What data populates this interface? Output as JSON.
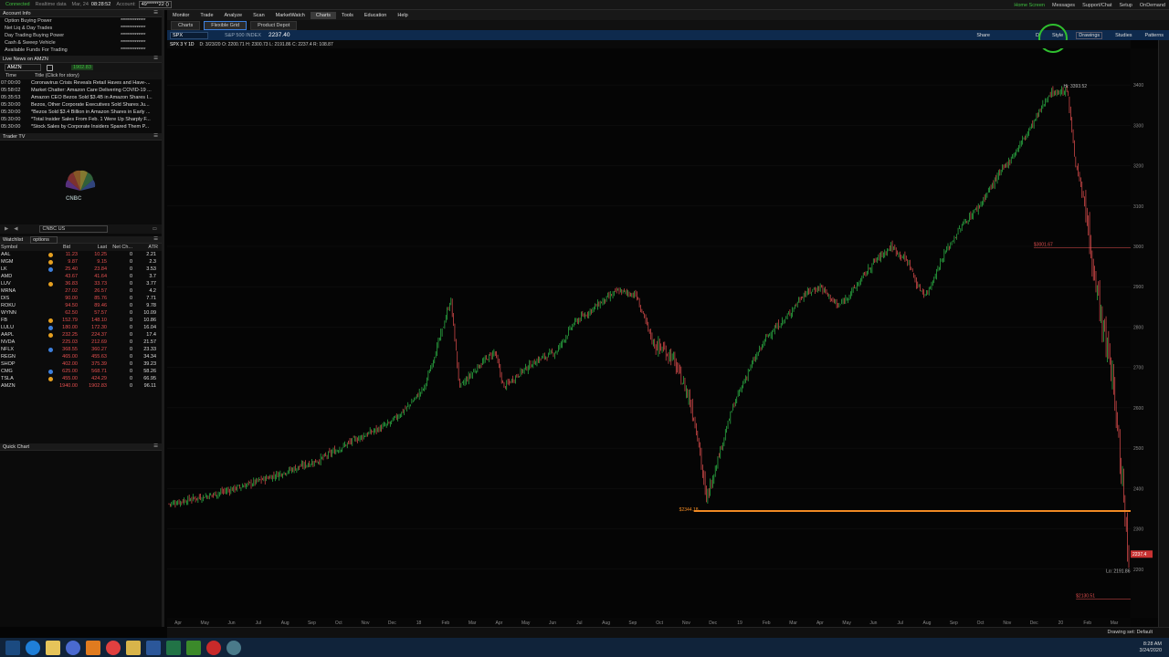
{
  "topbar": {
    "status": "Connected",
    "data": "Realtime data",
    "date": "Mar, 24",
    "time": "08:28:52",
    "account_label": "Account:",
    "account": "49******22 ()",
    "right": [
      "Home Screen",
      "Messages",
      "Support/Chat",
      "Setup",
      "OnDemand"
    ]
  },
  "account_info": {
    "title": "Account Info",
    "rows": [
      {
        "label": "Option Buying Power",
        "value": "**************"
      },
      {
        "label": "Net Liq & Day Trades",
        "value": "**************"
      },
      {
        "label": "Day Trading Buying Power",
        "value": "**************"
      },
      {
        "label": "Cash & Sweep Vehicle",
        "value": "**************"
      },
      {
        "label": "Available Funds For Trading",
        "value": "**************"
      }
    ]
  },
  "news": {
    "title": "Live News on AMZN",
    "symbol": "AMZN",
    "price": "1902.83",
    "col_time": "Time",
    "col_title": "Title (Click for story)",
    "items": [
      {
        "time": "07:00:00",
        "title": "Coronavirus Crisis Reveals Retail Haves and Have-..."
      },
      {
        "time": "05:58:02",
        "title": "Market Chatter: Amazon Care Delivering COVID-19 ..."
      },
      {
        "time": "05:35:53",
        "title": "Amazon CEO Bezos Sold $3.4B in Amazon Shares I..."
      },
      {
        "time": "05:30:00",
        "title": "Bezos, Other Corporate Executives Sold Shares Ju..."
      },
      {
        "time": "05:30:00",
        "title": "*Bezos Sold $3.4 Billion in Amazon Shares in Early ..."
      },
      {
        "time": "05:30:00",
        "title": "*Total Insider Sales From Feb. 1 Were Up Sharply F..."
      },
      {
        "time": "05:30:00",
        "title": "*Stock Sales by Corporate Insiders Spared Them P..."
      }
    ]
  },
  "tradertv": {
    "title": "Trader TV",
    "logo": "CNBC",
    "channel": "CNBC US"
  },
  "watchlist": {
    "title": "Watchlist",
    "list": "options",
    "cols": [
      "Symbol",
      "Bid",
      "Last",
      "Net Ch...",
      "ATR"
    ],
    "rows": [
      {
        "s": "AAL",
        "bid": "11.23",
        "last": "10.25",
        "net": "0",
        "atr": "2.21",
        "icon": "#e6a020"
      },
      {
        "s": "MGM",
        "bid": "9.87",
        "last": "9.15",
        "net": "0",
        "atr": "2.3",
        "icon": "#e6a020"
      },
      {
        "s": "LK",
        "bid": "25.40",
        "last": "23.84",
        "net": "0",
        "atr": "3.53",
        "icon": "#3d7fdc"
      },
      {
        "s": "AMD",
        "bid": "43.67",
        "last": "41.64",
        "net": "0",
        "atr": "3.7",
        "icon": ""
      },
      {
        "s": "LUV",
        "bid": "36.83",
        "last": "33.73",
        "net": "0",
        "atr": "3.77",
        "icon": "#e6a020"
      },
      {
        "s": "MRNA",
        "bid": "27.02",
        "last": "26.57",
        "net": "0",
        "atr": "4.2",
        "icon": ""
      },
      {
        "s": "DIS",
        "bid": "90.00",
        "last": "85.76",
        "net": "0",
        "atr": "7.71",
        "icon": ""
      },
      {
        "s": "ROKU",
        "bid": "94.50",
        "last": "89.46",
        "net": "0",
        "atr": "9.78",
        "icon": ""
      },
      {
        "s": "WYNN",
        "bid": "62.50",
        "last": "57.57",
        "net": "0",
        "atr": "10.09",
        "icon": ""
      },
      {
        "s": "FB",
        "bid": "152.79",
        "last": "148.10",
        "net": "0",
        "atr": "10.86",
        "icon": "#e6a020"
      },
      {
        "s": "LULU",
        "bid": "180.00",
        "last": "172.30",
        "net": "0",
        "atr": "16.04",
        "icon": "#3d7fdc"
      },
      {
        "s": "AAPL",
        "bid": "232.25",
        "last": "224.37",
        "net": "0",
        "atr": "17.4",
        "icon": "#e6a020"
      },
      {
        "s": "NVDA",
        "bid": "225.03",
        "last": "212.69",
        "net": "0",
        "atr": "21.57",
        "icon": ""
      },
      {
        "s": "NFLX",
        "bid": "368.55",
        "last": "360.27",
        "net": "0",
        "atr": "23.33",
        "icon": "#3d7fdc"
      },
      {
        "s": "REGN",
        "bid": "465.00",
        "last": "455.63",
        "net": "0",
        "atr": "34.34",
        "icon": ""
      },
      {
        "s": "SHOP",
        "bid": "402.00",
        "last": "375.39",
        "net": "0",
        "atr": "39.23",
        "icon": ""
      },
      {
        "s": "CMG",
        "bid": "625.00",
        "last": "568.71",
        "net": "0",
        "atr": "58.26",
        "icon": "#3d7fdc"
      },
      {
        "s": "TSLA",
        "bid": "455.00",
        "last": "424.29",
        "net": "0",
        "atr": "66.95",
        "icon": "#e6a020"
      },
      {
        "s": "AMZN",
        "bid": "1940.00",
        "last": "1902.83",
        "net": "0",
        "atr": "96.11",
        "icon": ""
      }
    ]
  },
  "quickchart": {
    "title": "Quick Chart"
  },
  "menu": [
    "Monitor",
    "Trade",
    "Analyze",
    "Scan",
    "MarketWatch",
    "Charts",
    "Tools",
    "Education",
    "Help"
  ],
  "menu_active": "Charts",
  "tabs": [
    "Charts",
    "Flexible Grid",
    "Product Depot"
  ],
  "symbar": {
    "symbol": "SPX",
    "name": "S&P 500 INDEX",
    "last": "2237.40",
    "right": [
      "Share",
      "D",
      "Style",
      "Drawings",
      "Studies",
      "Patterns"
    ]
  },
  "infobar": {
    "period": "SPX 3 Y 1D",
    "ohlc": "D: 3/23/20  O: 2200.71  H: 2300.73  L: 2191.86  C: 2237.4  R: 108.87"
  },
  "chart_data": {
    "type": "candlestick",
    "title": "SPX 3 Y 1D",
    "ylim": [
      2100,
      3450
    ],
    "y_ticks": [
      2200,
      2300,
      2400,
      2500,
      2600,
      2700,
      2800,
      2900,
      3000,
      3100,
      3200,
      3300,
      3400
    ],
    "x_ticks": [
      "Apr",
      "May",
      "Jun",
      "Jul",
      "Aug",
      "Sep",
      "Oct",
      "Nov",
      "Dec",
      "18",
      "Feb",
      "Mar",
      "Apr",
      "May",
      "Jun",
      "Jul",
      "Aug",
      "Sep",
      "Oct",
      "Nov",
      "Dec",
      "19",
      "Feb",
      "Mar",
      "Apr",
      "May",
      "Jun",
      "Jul",
      "Aug",
      "Sep",
      "Oct",
      "Nov",
      "Dec",
      "20",
      "Feb",
      "Mar"
    ],
    "close_path": [
      [
        0,
        2362
      ],
      [
        5,
        2385
      ],
      [
        9,
        2410
      ],
      [
        13,
        2440
      ],
      [
        17,
        2470
      ],
      [
        21,
        2520
      ],
      [
        25,
        2560
      ],
      [
        27,
        2600
      ],
      [
        29,
        2650
      ],
      [
        31,
        2790
      ],
      [
        32,
        2870
      ],
      [
        33,
        2650
      ],
      [
        35,
        2700
      ],
      [
        37,
        2740
      ],
      [
        38,
        2650
      ],
      [
        40,
        2690
      ],
      [
        42,
        2720
      ],
      [
        44,
        2740
      ],
      [
        46,
        2810
      ],
      [
        49,
        2860
      ],
      [
        51,
        2890
      ],
      [
        53,
        2880
      ],
      [
        55,
        2760
      ],
      [
        57,
        2730
      ],
      [
        59,
        2630
      ],
      [
        60,
        2540
      ],
      [
        61,
        2370
      ],
      [
        62,
        2450
      ],
      [
        64,
        2600
      ],
      [
        66,
        2700
      ],
      [
        68,
        2780
      ],
      [
        70,
        2820
      ],
      [
        72,
        2880
      ],
      [
        74,
        2900
      ],
      [
        76,
        2850
      ],
      [
        78,
        2900
      ],
      [
        80,
        2960
      ],
      [
        82,
        3000
      ],
      [
        84,
        2960
      ],
      [
        85,
        2900
      ],
      [
        86,
        2880
      ],
      [
        88,
        2980
      ],
      [
        90,
        3050
      ],
      [
        92,
        3100
      ],
      [
        94,
        3170
      ],
      [
        96,
        3230
      ],
      [
        98,
        3300
      ],
      [
        100,
        3380
      ],
      [
        102,
        3386
      ],
      [
        103,
        3200
      ],
      [
        104,
        3100
      ],
      [
        105,
        2950
      ],
      [
        106,
        2800
      ],
      [
        107,
        2700
      ],
      [
        108,
        2480
      ],
      [
        109,
        2237
      ]
    ],
    "annotations": [
      {
        "text": "Hi: 3393.52",
        "price": 3393.52
      },
      {
        "text": "$3001.67",
        "price": 3001.67
      },
      {
        "text": "$2344.18",
        "price": 2344.18
      },
      {
        "text": "Lo: 2191.86",
        "price": 2191.86
      },
      {
        "text": "$2130.51",
        "price": 2130.51
      }
    ],
    "horizontal_line": {
      "price": 2344.18,
      "color": "#f08a24"
    },
    "last_price": {
      "text": "2237.4",
      "price": 2237.4
    },
    "colors": {
      "up": "#2fbf4a",
      "down": "#e65050"
    }
  },
  "bottombar": {
    "status": "Drawing set: Default"
  },
  "clock": {
    "time": "8:28 AM",
    "date": "3/24/2020"
  }
}
